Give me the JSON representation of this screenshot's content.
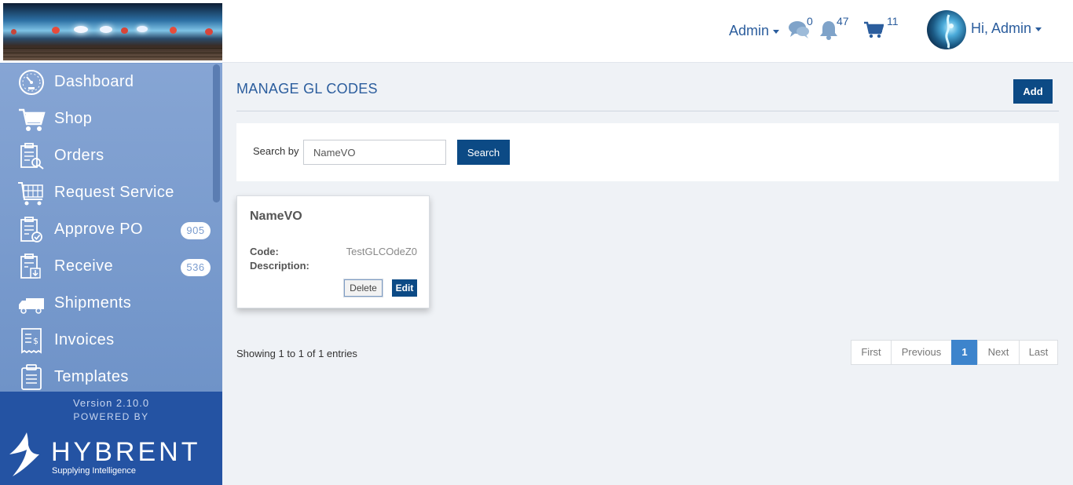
{
  "sidebar": {
    "items": [
      {
        "label": "Dashboard",
        "icon": "dashboard-icon"
      },
      {
        "label": "Shop",
        "icon": "shopping-cart-icon"
      },
      {
        "label": "Orders",
        "icon": "orders-clipboard-icon"
      },
      {
        "label": "Request Service",
        "icon": "request-service-cart-icon"
      },
      {
        "label": "Approve PO",
        "icon": "approve-clipboard-icon",
        "badge": "905"
      },
      {
        "label": "Receive",
        "icon": "receive-clipboard-icon",
        "badge": "536"
      },
      {
        "label": "Shipments",
        "icon": "truck-icon"
      },
      {
        "label": "Invoices",
        "icon": "invoice-icon"
      },
      {
        "label": "Templates",
        "icon": "templates-clipboard-icon"
      }
    ],
    "version": "Version 2.10.0",
    "powered_by": "POWERED BY",
    "brand": "HYBRENT",
    "tagline": "Supplying Intelligence"
  },
  "topbar": {
    "admin_menu": "Admin",
    "messages_count": "0",
    "notifications_count": "47",
    "cart_count": "11",
    "user_greeting": "Hi, Admin"
  },
  "main": {
    "title": "MANAGE GL CODES",
    "add_label": "Add",
    "search": {
      "label": "Search by",
      "value": "NameVO",
      "button": "Search"
    },
    "card": {
      "name": "NameVO",
      "code_label": "Code:",
      "code_value": "TestGLCOdeZ0",
      "description_label": "Description:",
      "delete_label": "Delete",
      "edit_label": "Edit"
    },
    "showing": "Showing 1 to 1 of 1 entries",
    "pagination": {
      "first": "First",
      "previous": "Previous",
      "current": "1",
      "next": "Next",
      "last": "Last"
    }
  },
  "colors": {
    "accent": "#0c4a85",
    "sidebar": "#7a9ccf",
    "footer": "#2453a3",
    "link": "#2b5d9d",
    "page_active": "#3d84cc"
  }
}
